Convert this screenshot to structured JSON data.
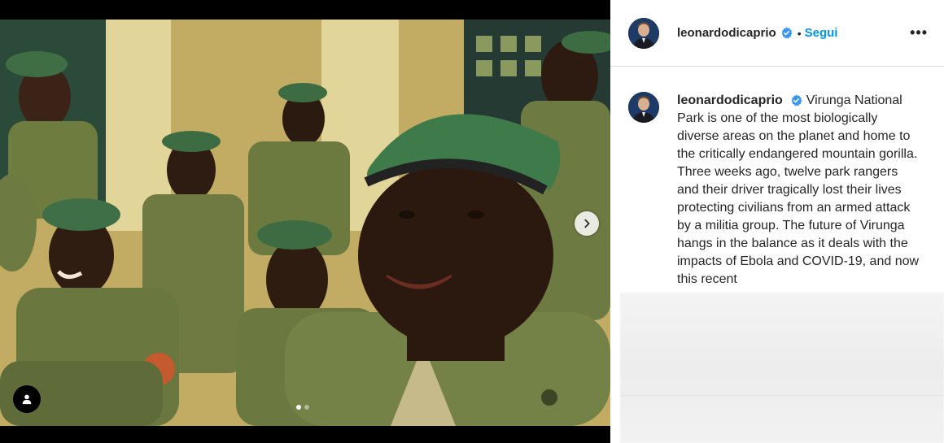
{
  "post": {
    "author": {
      "username": "leonardodicaprio",
      "verified": true
    },
    "header": {
      "follow_label": "Segui",
      "separator": "•",
      "more_label": "•••"
    },
    "caption": {
      "username": "leonardodicaprio",
      "text": "Virunga National Park is one of the most biologically diverse areas on the planet and home to the critically endangered mountain gorilla. Three weeks ago, twelve park rangers and their driver tragically lost their lives protecting civilians from an armed attack by a militia group. The future of Virunga hangs in the balance as it deals with the impacts of Ebola and COVID-19, and now this recent"
    },
    "carousel": {
      "current_index": 1,
      "total": 2
    },
    "icons": {
      "next": "chevron-right-icon",
      "tagged": "user-tag-icon",
      "verified": "verified-badge-icon",
      "more": "more-options-icon"
    },
    "colors": {
      "follow": "#0095f6",
      "verified": "#3897f0",
      "text": "#262626"
    }
  }
}
